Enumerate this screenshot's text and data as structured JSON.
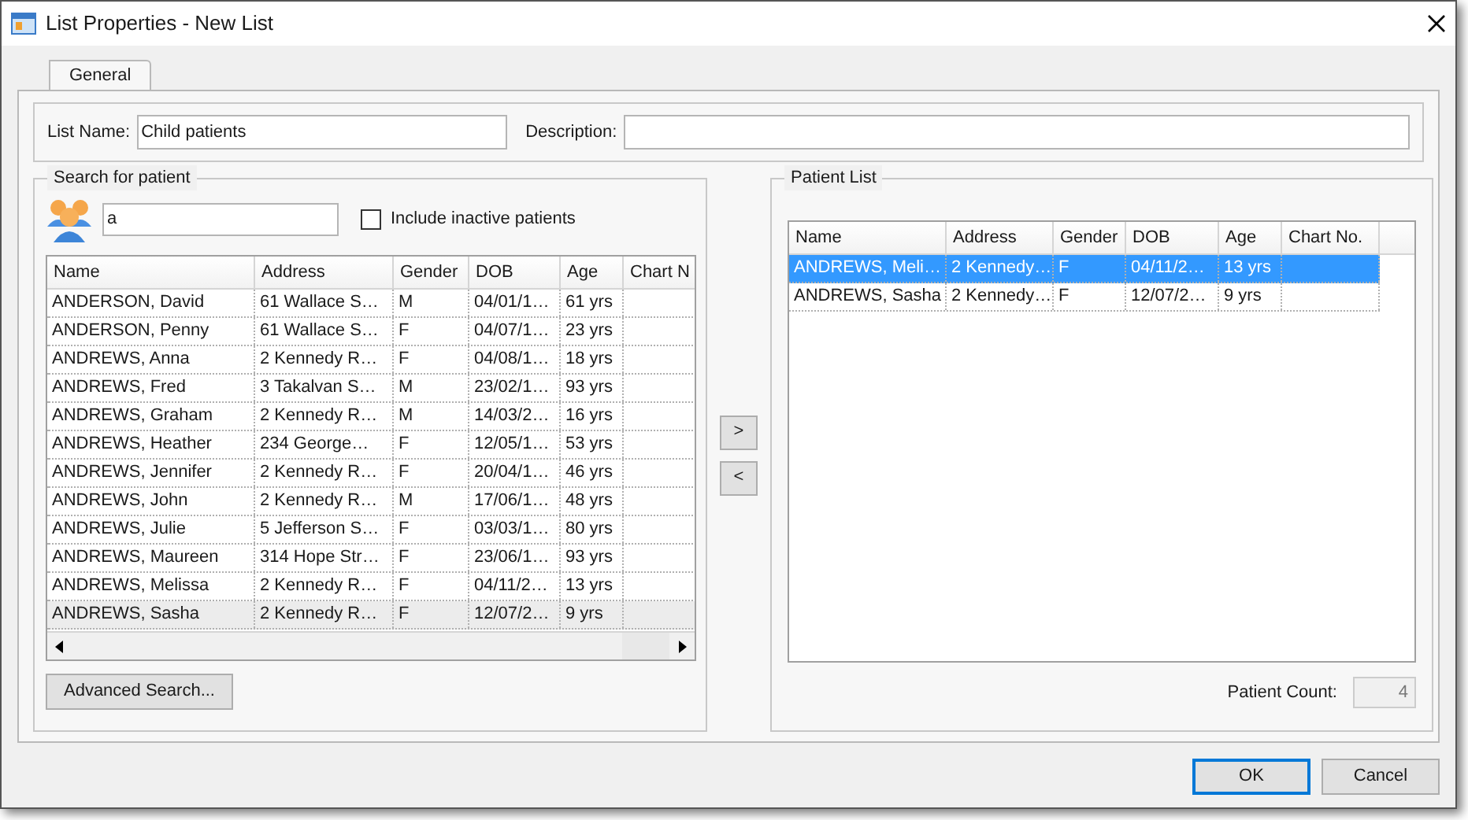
{
  "window": {
    "title": "List Properties - New List"
  },
  "tabs": [
    {
      "label": "General",
      "selected": true
    }
  ],
  "list_name": {
    "label": "List Name:",
    "value": "Child patients"
  },
  "description": {
    "label": "Description:"
  },
  "search": {
    "group_title": "Search for patient",
    "value": "a",
    "include_inactive": {
      "label": "Include inactive patients",
      "checked": false
    },
    "columns": [
      "Name",
      "Address",
      "Gender",
      "DOB",
      "Age",
      "Chart N"
    ],
    "rows": [
      {
        "cells": [
          "ANDERSON, David",
          "61 Wallace S…",
          "M",
          "04/01/1…",
          "61 yrs"
        ],
        "selected": false
      },
      {
        "cells": [
          "ANDERSON, Penny",
          "61 Wallace S…",
          "F",
          "04/07/1…",
          "23 yrs"
        ],
        "selected": false
      },
      {
        "cells": [
          "ANDREWS, Anna",
          "2 Kennedy R…",
          "F",
          "04/08/1…",
          "18 yrs"
        ],
        "selected": false
      },
      {
        "cells": [
          "ANDREWS, Fred",
          "3 Takalvan S…",
          "M",
          "23/02/1…",
          "93 yrs"
        ],
        "selected": false
      },
      {
        "cells": [
          "ANDREWS, Graham",
          "2 Kennedy R…",
          "M",
          "14/03/2…",
          "16 yrs"
        ],
        "selected": false
      },
      {
        "cells": [
          "ANDREWS, Heather",
          "234 George…",
          "F",
          "12/05/1…",
          "53 yrs"
        ],
        "selected": false
      },
      {
        "cells": [
          "ANDREWS, Jennifer",
          "2 Kennedy R…",
          "F",
          "20/04/1…",
          "46 yrs"
        ],
        "selected": false
      },
      {
        "cells": [
          "ANDREWS, John",
          "2 Kennedy R…",
          "M",
          "17/06/1…",
          "48 yrs"
        ],
        "selected": false
      },
      {
        "cells": [
          "ANDREWS, Julie",
          "5 Jefferson S…",
          "F",
          "03/03/1…",
          "80 yrs"
        ],
        "selected": false
      },
      {
        "cells": [
          "ANDREWS, Maureen",
          "314 Hope Str…",
          "F",
          "23/06/1…",
          "93 yrs"
        ],
        "selected": false
      },
      {
        "cells": [
          "ANDREWS, Melissa",
          "2 Kennedy R…",
          "F",
          "04/11/2…",
          "13 yrs"
        ],
        "selected": false
      },
      {
        "cells": [
          "ANDREWS, Sasha",
          "2 Kennedy R…",
          "F",
          "12/07/2…",
          "9 yrs"
        ],
        "selected": true
      }
    ],
    "advanced_button": "Advanced Search..."
  },
  "move_buttons": [
    ">",
    "<"
  ],
  "patient_list": {
    "group_title": "Patient List",
    "columns": [
      "Name",
      "Address",
      "Gender",
      "DOB",
      "Age",
      "Chart No."
    ],
    "rows": [
      {
        "cells": [
          "ANDREWS, Meli…",
          "2 Kennedy…",
          "F",
          "04/11/2…",
          "13 yrs"
        ],
        "selected": true
      },
      {
        "cells": [
          "ANDREWS, Sasha",
          "2 Kennedy…",
          "F",
          "12/07/2…",
          "9 yrs"
        ],
        "selected": false
      }
    ],
    "count_label": "Patient Count:",
    "count": "4"
  },
  "buttons": [
    {
      "label": "OK",
      "default": true
    },
    {
      "label": "Cancel",
      "default": false
    }
  ]
}
